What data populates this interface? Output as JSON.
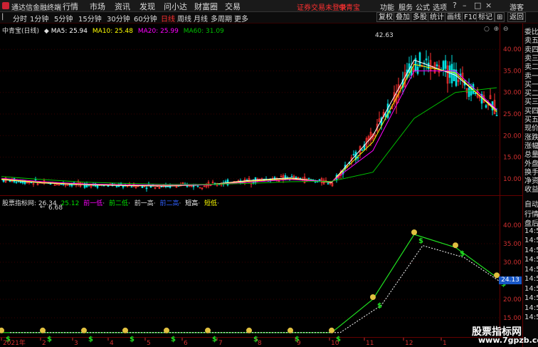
{
  "app": {
    "title": "通达信金融终端"
  },
  "menu": [
    "行情",
    "市场",
    "资讯",
    "发现",
    "问小达",
    "财富圈",
    "交易"
  ],
  "login_notice": "证券交易未登录",
  "stock_link": "中青宝",
  "top_right": [
    "功能",
    "服务",
    "公式",
    "选项",
    "游客"
  ],
  "periods": [
    "分时",
    "1分钟",
    "5分钟",
    "15分钟",
    "30分钟",
    "60分钟",
    "日线",
    "周线",
    "月线",
    "多周期",
    "更多"
  ],
  "active_period": "日线",
  "toolbar_right": [
    "复权",
    "叠加",
    "多股",
    "统计",
    "画线",
    "F10",
    "标记"
  ],
  "main_header": {
    "name": "中青宝(日线)",
    "ma5": "MA5: 25.94",
    "ma10": "MA10: 25.48",
    "ma20": "MA20: 25.99",
    "ma60": "MA60: 31.09"
  },
  "price_axis": [
    "40.00",
    "35.00",
    "30.00",
    "25.00",
    "20.00",
    "15.00",
    "10.00"
  ],
  "high_label": "42.63",
  "low_label": "6.68",
  "ind_header": {
    "name": "股票指标网",
    "v1": ": 26.34",
    "v2": "25.12",
    "t1": "前一低",
    "t2": "前二低",
    "t3": "前一高",
    "t4": "前二高",
    "t5": "短高",
    "t6": "短低"
  },
  "ind_axis": [
    "40.00",
    "35.00",
    "30.00",
    "25.00",
    "20.00",
    "15.00"
  ],
  "ind_current": "24.13",
  "date_labels": [
    "2021年",
    "2",
    "3",
    "4",
    "5",
    "6",
    "7",
    "8",
    "9",
    "10",
    "11",
    "12",
    "1"
  ],
  "right_panel_top": [
    "委比",
    "卖五",
    "卖四",
    "卖三",
    "卖二",
    "卖一",
    "买一",
    "买二",
    "买三",
    "买四",
    "买五",
    "现价",
    "涨跌",
    "涨幅",
    "总量",
    "外盘",
    "换手",
    "净资",
    "收益"
  ],
  "right_panel_bottom": [
    "自动",
    "行情",
    "盘后",
    "14:5",
    "14:5",
    "14:5",
    "14:5",
    "14:5",
    "14:5",
    "14:5",
    "14:5",
    "14:5",
    "14:5"
  ],
  "watermark": {
    "line1": "股票指标网",
    "line2": "www.7gpzb.com"
  },
  "colors": {
    "ma5": "#ffffff",
    "ma10": "#ffff00",
    "ma20": "#ff00ff",
    "ma60": "#00c000",
    "up": "#ff3030",
    "down": "#00e0e0",
    "active": "#ff3030"
  },
  "chart_data": {
    "type": "line",
    "title": "中青宝(日线)",
    "x": [
      "2021-01",
      "2021-02",
      "2021-03",
      "2021-04",
      "2021-05",
      "2021-06",
      "2021-07",
      "2021-08",
      "2021-09",
      "2021-10",
      "2021-11",
      "2021-12",
      "2022-01"
    ],
    "ylim": [
      6,
      44
    ],
    "series": [
      {
        "name": "MA5",
        "values": [
          9.8,
          9.0,
          8.6,
          8.4,
          8.3,
          8.6,
          9.6,
          10.2,
          9.1,
          20.0,
          37.5,
          34.0,
          25.9
        ]
      },
      {
        "name": "MA10",
        "values": [
          9.9,
          9.1,
          8.7,
          8.5,
          8.4,
          8.6,
          9.4,
          10.0,
          9.2,
          18.5,
          36.5,
          34.5,
          25.5
        ]
      },
      {
        "name": "MA20",
        "values": [
          10.1,
          9.3,
          8.8,
          8.6,
          8.5,
          8.6,
          9.2,
          9.8,
          9.3,
          16.5,
          35.0,
          35.0,
          26.0
        ]
      },
      {
        "name": "MA60",
        "values": [
          10.5,
          9.8,
          9.2,
          8.9,
          8.7,
          8.7,
          8.9,
          9.3,
          9.4,
          11.5,
          24.0,
          30.0,
          31.1
        ]
      }
    ]
  }
}
